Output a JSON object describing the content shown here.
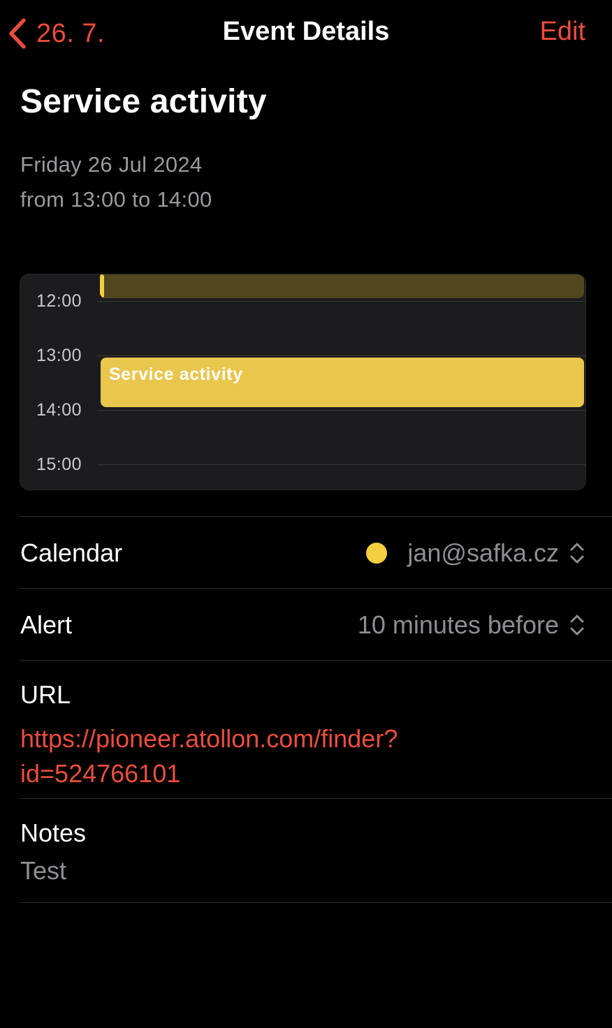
{
  "colors": {
    "accent": "#eb4d3d",
    "calendar_dot": "#f4cf3f",
    "event_fill": "#e9c64c"
  },
  "nav": {
    "back_icon": "chevron-left-icon",
    "back_label": "26. 7.",
    "title": "Event Details",
    "edit_label": "Edit"
  },
  "event": {
    "title": "Service activity",
    "date": "Friday 26 Jul 2024",
    "time": "from 13:00 to 14:00"
  },
  "timeline": {
    "hours": [
      "12:00",
      "13:00",
      "14:00",
      "15:00"
    ],
    "event_label": "Service activity",
    "event_start": "13:00",
    "event_end": "14:00"
  },
  "details": {
    "calendar": {
      "label": "Calendar",
      "value": "jan@safka.cz",
      "icon": "chevron-updown-icon"
    },
    "alert": {
      "label": "Alert",
      "value": "10 minutes before",
      "icon": "chevron-updown-icon"
    },
    "url": {
      "label": "URL",
      "value": "https://pioneer.atollon.com/finder?id=524766101"
    },
    "notes": {
      "label": "Notes",
      "value": "Test"
    }
  }
}
